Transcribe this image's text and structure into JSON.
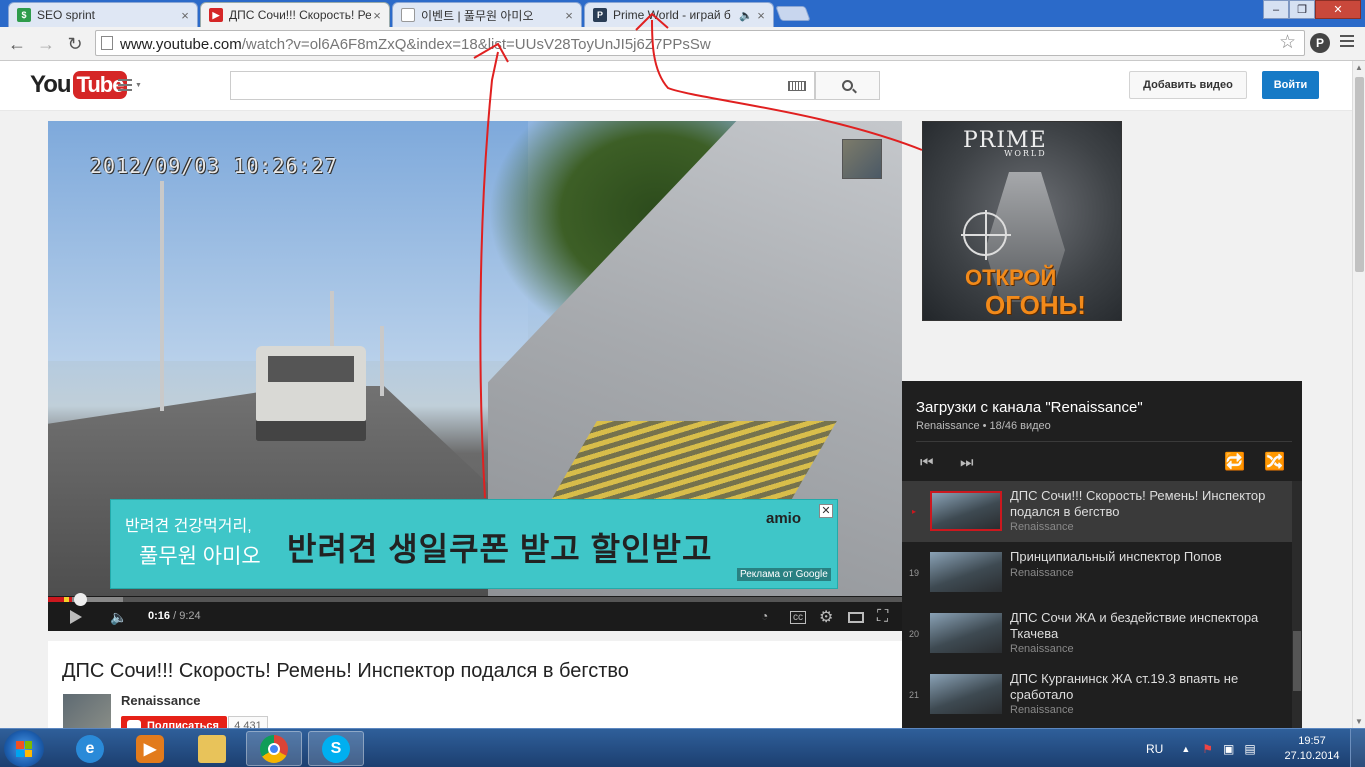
{
  "browser": {
    "tabs": [
      {
        "title": "SEO sprint",
        "icon": "seo-sprint-favicon",
        "active": false
      },
      {
        "title": "ДПС Сочи!!! Скорость! Ре",
        "icon": "youtube-favicon",
        "active": true
      },
      {
        "title": "이벤트 | 풀무원 아미오",
        "icon": "page-favicon",
        "active": false
      },
      {
        "title": "Prime World - играй б",
        "icon": "primeworld-favicon",
        "active": false
      }
    ],
    "url_host": "www.youtube.com",
    "url_rest": "/watch?v=ol6A6F8mZxQ&index=18&list=UUsV28ToyUnJI5j6Z7PPsSw",
    "extension_label": "P",
    "window_buttons": {
      "minimize": "‒",
      "maximize": "❐",
      "close": "✕"
    }
  },
  "youtube": {
    "logo_you": "You",
    "logo_tube": "Tube",
    "search_placeholder": "",
    "upload_label": "Добавить видео",
    "signin_label": "Войти"
  },
  "player": {
    "timestamp": "2012/09/03 10:26:27",
    "current_time": "0:16",
    "duration": "9:24",
    "progress_fraction": 0.028,
    "ad": {
      "line1": "반려견 건강먹거리,",
      "line2": "풀무원 아미오",
      "headline": "반려견 생일쿠폰 받고 할인받고",
      "brand": "amio",
      "label": "Реклама от Google"
    }
  },
  "side_ad": {
    "brand": "PRIME",
    "brand_sub": "WORLD",
    "cta_line1": "ОТКРОЙ",
    "cta_line2": "ОГОНЬ!"
  },
  "playlist": {
    "title": "Загрузки с канала \"Renaissance\"",
    "subtitle": "Renaissance • 18/46 видео",
    "items": [
      {
        "index": "▸",
        "title": "ДПС Сочи!!! Скорость! Ремень! Инспектор подался в бегство",
        "owner": "Renaissance",
        "current": true
      },
      {
        "index": "19",
        "title": "Принципиальный инспектор Попов",
        "owner": "Renaissance",
        "current": false
      },
      {
        "index": "20",
        "title": "ДПС Сочи ЖА и бездействие инспектора Ткачева",
        "owner": "Renaissance",
        "current": false
      },
      {
        "index": "21",
        "title": "ДПС Курганинск ЖА ст.19.3 впаять не сработало",
        "owner": "Renaissance",
        "current": false
      }
    ]
  },
  "video": {
    "title": "ДПС Сочи!!! Скорость! Ремень! Инспектор подался в бегство",
    "owner": "Renaissance",
    "subscribe_label": "Подписаться",
    "subscriber_count": "4 431"
  },
  "taskbar": {
    "language": "RU",
    "time": "19:57",
    "date": "27.10.2014",
    "apps": [
      "internet-explorer",
      "media-player",
      "file-explorer",
      "chrome",
      "skype"
    ]
  },
  "colors": {
    "youtube_red": "#cc181e",
    "signin_blue": "#167ac6",
    "annotation_red": "#e02020"
  }
}
